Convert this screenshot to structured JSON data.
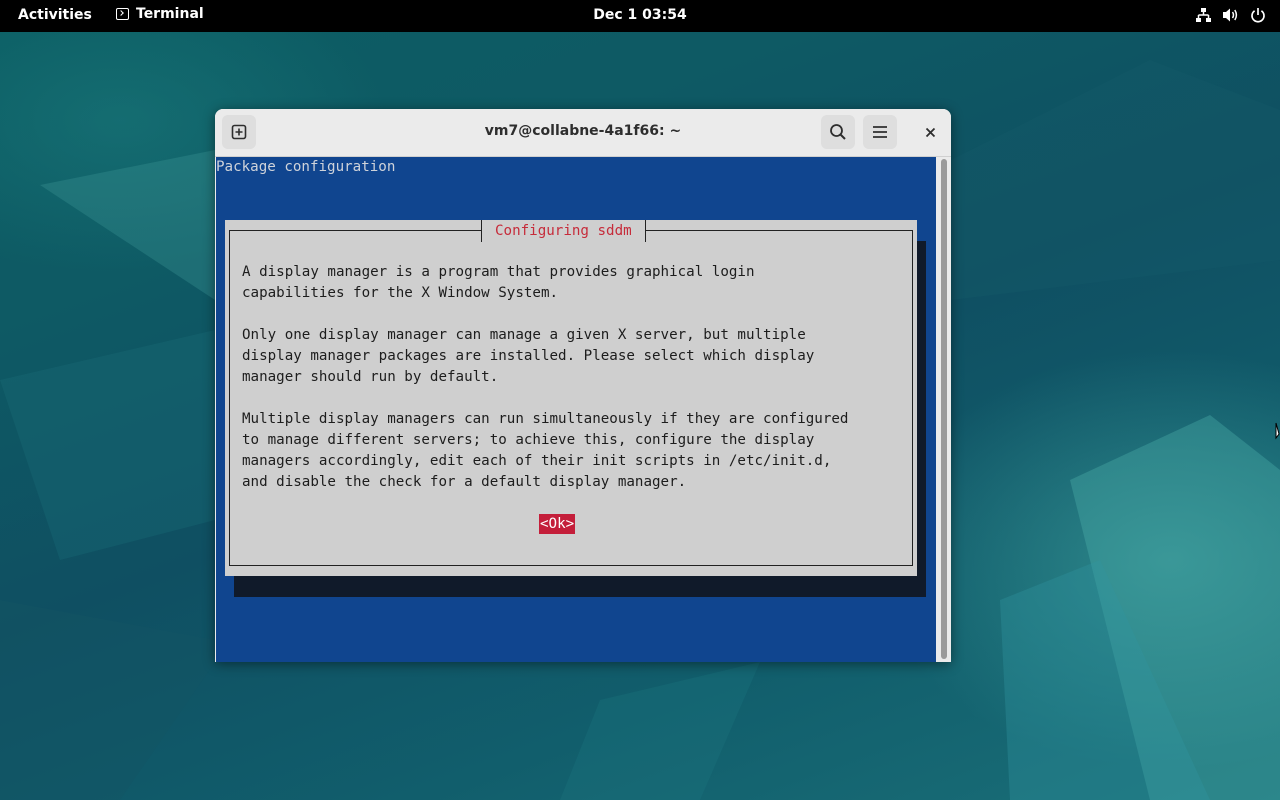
{
  "topbar": {
    "activities": "Activities",
    "app_name": "Terminal",
    "clock": "Dec 1  03:54",
    "tray_icons": [
      "network-icon",
      "volume-icon",
      "power-icon"
    ]
  },
  "window": {
    "title": "vm7@collabne-4a1f66: ~",
    "buttons": [
      "new-tab-icon",
      "search-icon",
      "hamburger-menu-icon",
      "close-icon"
    ]
  },
  "terminal": {
    "header": "Package configuration",
    "dialog": {
      "title": "Configuring sddm",
      "paragraphs": [
        "A display manager is a program that provides graphical login\ncapabilities for the X Window System.",
        "Only one display manager can manage a given X server, but multiple\ndisplay manager packages are installed. Please select which display\nmanager should run by default.",
        "Multiple display managers can run simultaneously if they are configured\nto manage different servers; to achieve this, configure the display\nmanagers accordingly, edit each of their init scripts in /etc/init.d,\nand disable the check for a default display manager."
      ],
      "ok_label": "<Ok>"
    }
  },
  "colors": {
    "terminal_bg": "#10458f",
    "dialog_bg": "#cfcfcf",
    "dialog_title": "#c62b3a",
    "ok_button_bg": "#c41e3a"
  }
}
